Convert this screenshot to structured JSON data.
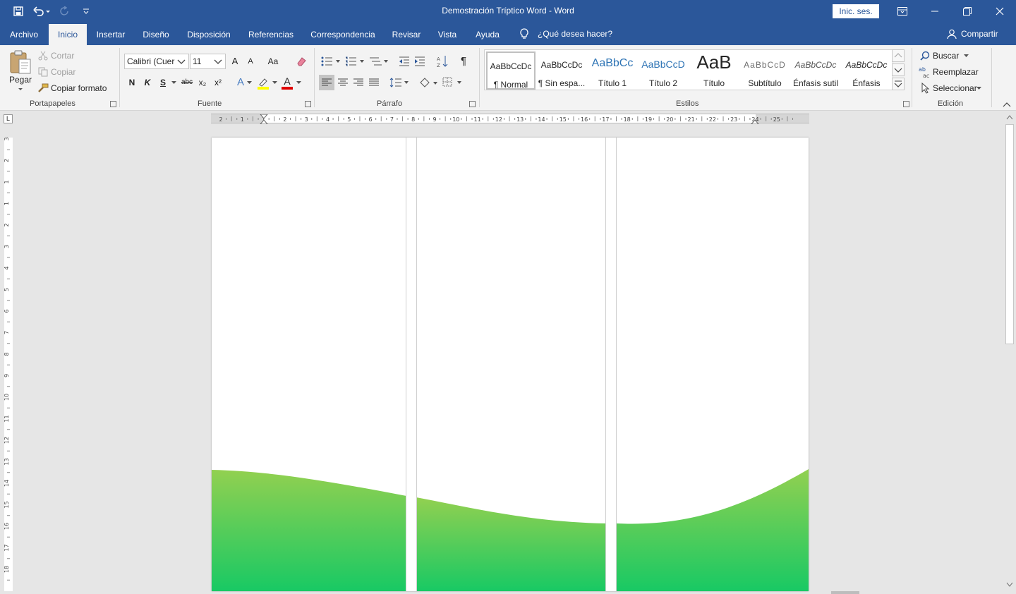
{
  "window": {
    "title": "Demostración Tríptico Word  -  Word",
    "signin_label": "Inic. ses."
  },
  "tabs": [
    {
      "label": "Archivo"
    },
    {
      "label": "Inicio"
    },
    {
      "label": "Insertar"
    },
    {
      "label": "Diseño"
    },
    {
      "label": "Disposición"
    },
    {
      "label": "Referencias"
    },
    {
      "label": "Correspondencia"
    },
    {
      "label": "Revisar"
    },
    {
      "label": "Vista"
    },
    {
      "label": "Ayuda"
    }
  ],
  "tellme": {
    "label": "¿Qué desea hacer?"
  },
  "share": {
    "label": "Compartir"
  },
  "clipboard": {
    "paste_label": "Pegar",
    "cut_label": "Cortar",
    "copy_label": "Copiar",
    "format_painter_label": "Copiar formato",
    "group_label": "Portapapeles"
  },
  "font": {
    "font_name": "Calibri (Cuer",
    "font_size": "11",
    "grow_label": "A",
    "shrink_label": "A",
    "case_label": "Aa",
    "bold_label": "N",
    "italic_label": "K",
    "underline_label": "S",
    "strike_label": "abc",
    "subscript_label": "x₂",
    "superscript_label": "x²",
    "effects_label": "A",
    "color_label": "A",
    "group_label": "Fuente"
  },
  "paragraph": {
    "sort_label": "A↓Z",
    "pilcrow_label": "¶",
    "group_label": "Párrafo"
  },
  "styles": {
    "items": [
      {
        "sample": "AaBbCcDc",
        "name": "¶ Normal"
      },
      {
        "sample": "AaBbCcDc",
        "name": "¶ Sin espa..."
      },
      {
        "sample": "AaBbCc",
        "name": "Título 1"
      },
      {
        "sample": "AaBbCcD",
        "name": "Título 2"
      },
      {
        "sample": "AaB",
        "name": "Título"
      },
      {
        "sample": "AaBbCcD",
        "name": "Subtítulo"
      },
      {
        "sample": "AaBbCcDc",
        "name": "Énfasis sutil"
      },
      {
        "sample": "AaBbCcDc",
        "name": "Énfasis"
      }
    ],
    "group_label": "Estilos"
  },
  "editing": {
    "find_label": "Buscar",
    "replace_label": "Reemplazar",
    "select_label": "Seleccionar",
    "group_label": "Edición"
  },
  "ruler": {
    "h_numbers": [
      "2",
      "1",
      "1",
      "2",
      "3",
      "4",
      "5",
      "6",
      "7",
      "8",
      "9",
      "10",
      "11",
      "12",
      "13",
      "14",
      "15",
      "16",
      "17",
      "18",
      "19",
      "20",
      "21",
      "22",
      "23",
      "24",
      "25"
    ],
    "v_numbers": [
      "3",
      "2",
      "1",
      "1",
      "2",
      "3",
      "4",
      "5",
      "6",
      "7",
      "8",
      "9",
      "10",
      "11",
      "12",
      "13",
      "14",
      "15",
      "16",
      "17",
      "18"
    ],
    "tab_stop_label": "L"
  },
  "colors": {
    "accent": "#2b579a",
    "wave_top": "#92d050",
    "wave_bottom": "#18c964"
  }
}
